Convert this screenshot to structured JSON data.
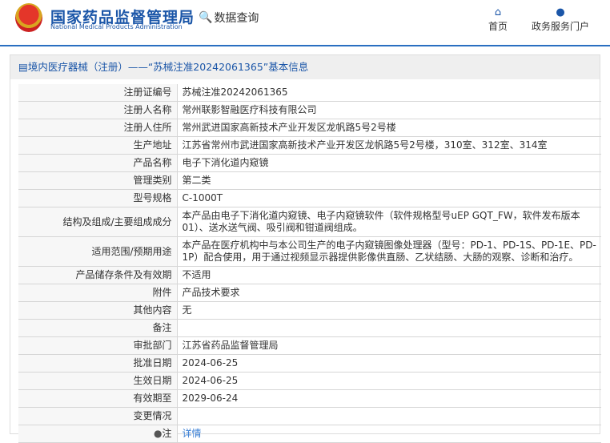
{
  "header": {
    "logo_cn": "国家药品监督管理局",
    "logo_en": "National Medical Products Administration",
    "query_label": "数据查询",
    "nav": [
      {
        "label": "首页",
        "icon": "home-icon"
      },
      {
        "label": "政务服务门户",
        "icon": "user-icon"
      }
    ]
  },
  "panel": {
    "title": "境内医疗器械（注册）——“苏械注准20242061365”基本信息"
  },
  "rows": [
    {
      "label": "注册证编号",
      "value": "苏械注准20242061365"
    },
    {
      "label": "注册人名称",
      "value": "常州联影智融医疗科技有限公司"
    },
    {
      "label": "注册人住所",
      "value": "常州武进国家高新技术产业开发区龙帆路5号2号楼"
    },
    {
      "label": "生产地址",
      "value": "江苏省常州市武进国家高新技术产业开发区龙帆路5号2号楼，310室、312室、314室"
    },
    {
      "label": "产品名称",
      "value": "电子下消化道内窥镜"
    },
    {
      "label": "管理类别",
      "value": "第二类"
    },
    {
      "label": "型号规格",
      "value": "C-1000T"
    },
    {
      "label": "结构及组成/主要组成成分",
      "value": "本产品由电子下消化道内窥镜、电子内窥镜软件（软件规格型号uEP GQT_FW，软件发布版本01）、送水送气阀、吸引阀和钳道阀组成。"
    },
    {
      "label": "适用范围/预期用途",
      "value": "本产品在医疗机构中与本公司生产的电子内窥镜图像处理器（型号：PD-1、PD-1S、PD-1E、PD-1P）配合使用，用于通过视频显示器提供影像供直肠、乙状结肠、大肠的观察、诊断和治疗。"
    },
    {
      "label": "产品储存条件及有效期",
      "value": "不适用"
    },
    {
      "label": "附件",
      "value": "产品技术要求"
    },
    {
      "label": "其他内容",
      "value": "无"
    },
    {
      "label": "备注",
      "value": ""
    },
    {
      "label": "审批部门",
      "value": "江苏省药品监督管理局"
    },
    {
      "label": "批准日期",
      "value": "2024-06-25"
    },
    {
      "label": "生效日期",
      "value": "2024-06-25"
    },
    {
      "label": "有效期至",
      "value": "2029-06-24"
    },
    {
      "label": "变更情况",
      "value": ""
    }
  ],
  "note": {
    "label": "注",
    "link": "详情"
  }
}
